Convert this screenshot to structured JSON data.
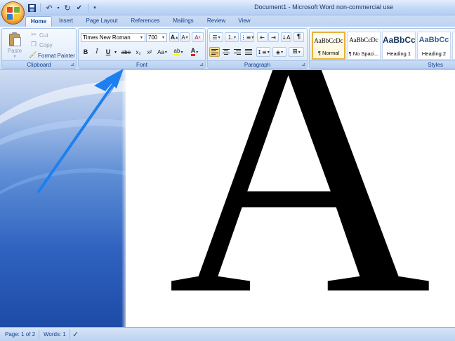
{
  "window": {
    "title": "Document1 - Microsoft Word non-commercial use"
  },
  "quick_access": {
    "save_icon": "save-icon",
    "undo_icon": "undo-icon",
    "redo_icon": "redo-icon",
    "spelling_icon": "spelling-check-icon"
  },
  "tabs": [
    "Home",
    "Insert",
    "Page Layout",
    "References",
    "Mailings",
    "Review",
    "View"
  ],
  "ribbon": {
    "clipboard": {
      "label": "Clipboard",
      "paste": "Paste",
      "cut": "Cut",
      "copy": "Copy",
      "format_painter": "Format Painter"
    },
    "font": {
      "label": "Font",
      "font_name": "Times New Roman",
      "font_size": "700",
      "grow": "A",
      "shrink": "A",
      "bold": "B",
      "italic": "I",
      "underline": "U",
      "strikethrough": "abe",
      "subscript": "x₂",
      "superscript": "x²",
      "change_case": "Aa",
      "font_color": "A"
    },
    "paragraph": {
      "label": "Paragraph",
      "pilcrow": "¶"
    },
    "styles": {
      "label": "Styles",
      "items": [
        {
          "sample": "AaBbCcDc",
          "name": "¶ Normal"
        },
        {
          "sample": "AaBbCcDc",
          "name": "¶ No Spaci..."
        },
        {
          "sample": "AaBbCc",
          "name": "Heading 1"
        },
        {
          "sample": "AaBbCc",
          "name": "Heading 2"
        }
      ]
    }
  },
  "document": {
    "content": "A"
  },
  "status": {
    "page": "Page: 1 of 2",
    "words": "Words: 1"
  },
  "colors": {
    "accent": "#15428b",
    "arrow": "#1e7ff0",
    "highlight": "#f9c75d"
  }
}
